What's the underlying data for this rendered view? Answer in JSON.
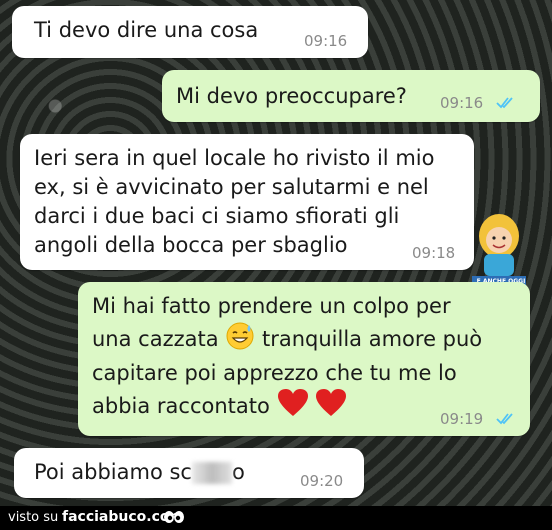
{
  "messages": [
    {
      "id": "m1",
      "text": "Ti devo dire una cosa",
      "time": "09:16"
    },
    {
      "id": "m2",
      "text": "Mi devo preoccupare?",
      "time": "09:16"
    },
    {
      "id": "m3",
      "text": "Ieri sera in quel locale ho rivisto il mio\nex, si è avvicinato per salutarmi e nel\ndarci i due baci ci siamo sfiorati gli\nangoli della bocca per sbaglio",
      "time": "09:18"
    },
    {
      "id": "m4",
      "line1": "Mi hai fatto prendere un colpo per",
      "line2a": "una cazzata",
      "line2b": "tranquilla amore può",
      "line3": "capitare poi apprezzo che tu me lo",
      "line4": "abbia raccontato",
      "time": "09:19"
    },
    {
      "id": "m5",
      "text_before": "Poi abbiamo sc",
      "text_after": "o",
      "time": "09:20"
    }
  ],
  "sticker": {
    "caption": "E ANCHE OGGI\nSI RIMORCHIA DOMANI"
  },
  "footer": {
    "label": "visto su",
    "site": "facciabuco.com"
  },
  "colors": {
    "incoming": "#ffffff",
    "outgoing": "#dcf8c6",
    "read_ticks": "#4fc3f7",
    "heart": "#e02020"
  }
}
